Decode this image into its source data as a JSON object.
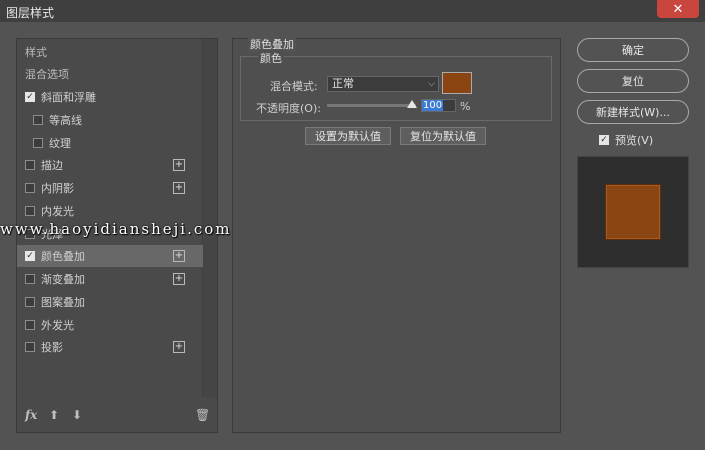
{
  "titlebar": {
    "title": "图层样式",
    "close_glyph": "✕"
  },
  "left_panel": {
    "items": [
      {
        "label": "样式",
        "header": true
      },
      {
        "label": "混合选项",
        "header": true
      },
      {
        "label": "斜面和浮雕",
        "checked": true
      },
      {
        "label": "等高线",
        "checked": false,
        "sub": true
      },
      {
        "label": "纹理",
        "checked": false,
        "sub": true
      },
      {
        "label": "描边",
        "checked": false,
        "plus": true
      },
      {
        "label": "内阴影",
        "checked": false,
        "plus": true
      },
      {
        "label": "内发光",
        "checked": false
      },
      {
        "label": "光泽",
        "checked": false
      },
      {
        "label": "颜色叠加",
        "checked": true,
        "plus": true,
        "selected": true
      },
      {
        "label": "渐变叠加",
        "checked": false,
        "plus": true
      },
      {
        "label": "图案叠加",
        "checked": false
      },
      {
        "label": "外发光",
        "checked": false
      },
      {
        "label": "投影",
        "checked": false,
        "plus": true
      }
    ],
    "bottom_icons": {
      "fx": "fx",
      "up": "⬆",
      "down": "⬇",
      "trash": "🗑"
    }
  },
  "main": {
    "group_title": "颜色叠加",
    "fieldset_legend": "颜色",
    "blend_label": "混合模式:",
    "blend_value": "正常",
    "color": "#8b4513",
    "opacity_label": "不透明度(O):",
    "opacity_value": "100",
    "opacity_unit": "%",
    "set_default_label": "设置为默认值",
    "reset_default_label": "复位为默认值"
  },
  "right": {
    "ok_label": "确定",
    "reset_label": "复位",
    "new_style_label": "新建样式(W)...",
    "preview_label": "预览(V)",
    "preview_checked": true
  },
  "watermark": "www.haoyidiansheji.com"
}
